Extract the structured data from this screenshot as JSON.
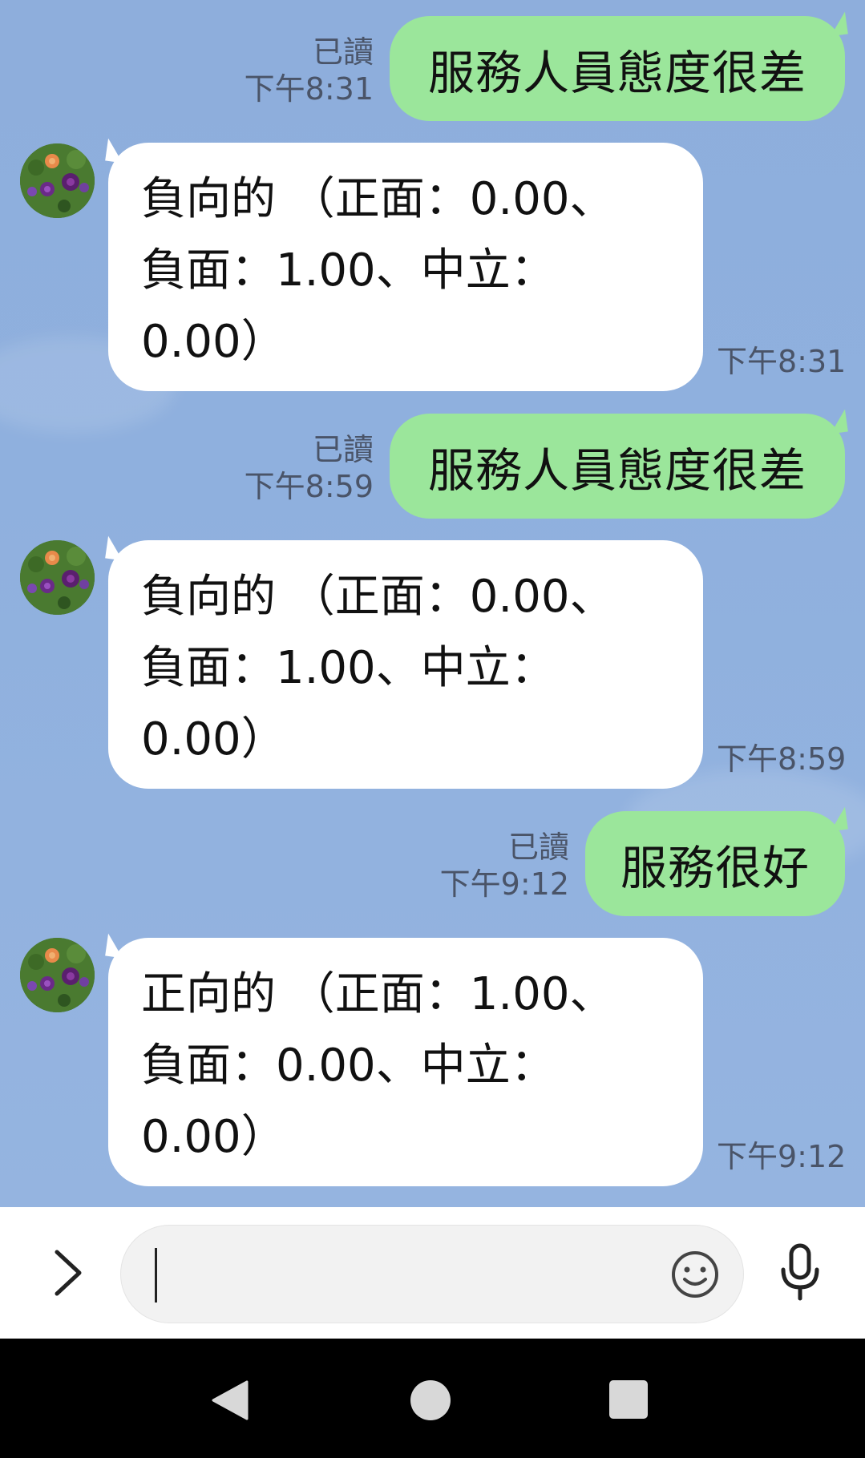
{
  "conversation": [
    {
      "type": "sent",
      "text": "服務人員態度很差",
      "read_status": "已讀",
      "time": "下午8:31"
    },
    {
      "type": "received",
      "lines": [
        "負向的 （正面：0.00、",
        "負面：1.00、中立：",
        "0.00）"
      ],
      "time": "下午8:31"
    },
    {
      "type": "sent",
      "text": "服務人員態度很差",
      "read_status": "已讀",
      "time": "下午8:59"
    },
    {
      "type": "received",
      "lines": [
        "負向的 （正面：0.00、",
        "負面：1.00、中立：",
        "0.00）"
      ],
      "time": "下午8:59"
    },
    {
      "type": "sent",
      "text": "服務很好",
      "read_status": "已讀",
      "time": "下午9:12"
    },
    {
      "type": "received",
      "lines": [
        "正向的 （正面：1.00、",
        "負面：0.00、中立：",
        "0.00）"
      ],
      "time": "下午9:12"
    }
  ],
  "input_bar": {
    "message_value": "",
    "expand_icon": "chevron-right-icon",
    "emoji_icon": "smiley-icon",
    "voice_icon": "microphone-icon"
  },
  "nav_bar": {
    "back_icon": "back-triangle-icon",
    "home_icon": "home-circle-icon",
    "recent_icon": "recent-apps-square-icon"
  },
  "colors": {
    "sent_bubble": "#9be69b",
    "received_bubble": "#ffffff",
    "chat_background": "#8eaedc",
    "meta_text": "#4a5468"
  }
}
